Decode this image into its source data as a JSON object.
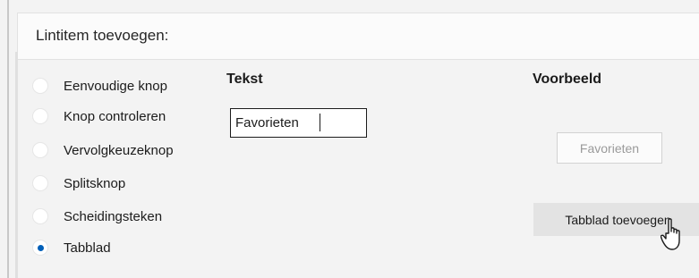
{
  "panel": {
    "title": "Lintitem toevoegen:"
  },
  "radio_options": [
    {
      "label": "Eenvoudige knop",
      "selected": false
    },
    {
      "label": "Knop controleren",
      "selected": false
    },
    {
      "label": "Vervolgkeuzeknop",
      "selected": false
    },
    {
      "label": "Splitsknop",
      "selected": false
    },
    {
      "label": "Scheidingsteken",
      "selected": false
    },
    {
      "label": "Tabblad",
      "selected": true
    }
  ],
  "text_section": {
    "heading": "Tekst",
    "input_value": "Favorieten"
  },
  "preview_section": {
    "heading": "Voorbeeld",
    "preview_button_label": "Favorieten"
  },
  "add_tab_button": {
    "label": "Tabblad toevoegen"
  },
  "colors": {
    "accent": "#005fb8",
    "background": "#f3f3f3",
    "button_hover": "#e3e3e3"
  },
  "cursor": {
    "icon": "hand-pointer-icon"
  }
}
